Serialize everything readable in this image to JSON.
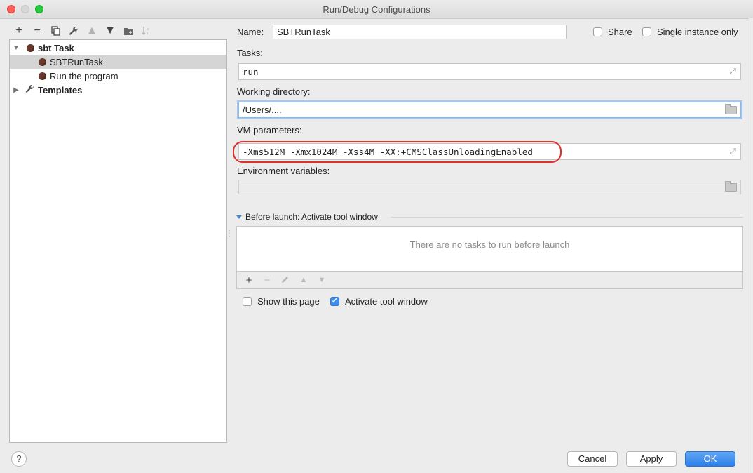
{
  "window": {
    "title": "Run/Debug Configurations"
  },
  "tree": {
    "groups": [
      {
        "label": "sbt Task",
        "children": [
          "SBTRunTask",
          "Run the program"
        ]
      },
      {
        "label": "Templates"
      }
    ],
    "selected": "SBTRunTask"
  },
  "form": {
    "name_label": "Name:",
    "name_value": "SBTRunTask",
    "share_label": "Share",
    "share_checked": false,
    "single_instance_label": "Single instance only",
    "single_instance_checked": false,
    "tasks_label": "Tasks:",
    "tasks_value": "run",
    "working_dir_label": "Working directory:",
    "working_dir_value": "/Users/....",
    "vm_params_label": "VM parameters:",
    "vm_params_value": "-Xms512M -Xmx1024M -Xss4M -XX:+CMSClassUnloadingEnabled",
    "env_vars_label": "Environment variables:",
    "env_vars_value": ""
  },
  "before_launch": {
    "header": "Before launch: Activate tool window",
    "empty_text": "There are no tasks to run before launch"
  },
  "options": {
    "show_page_label": "Show this page",
    "show_page_checked": false,
    "activate_window_label": "Activate tool window",
    "activate_window_checked": true
  },
  "buttons": {
    "help": "?",
    "cancel": "Cancel",
    "apply": "Apply",
    "ok": "OK"
  },
  "colors": {
    "accent": "#2d7fe8",
    "highlight": "#e0302b"
  }
}
